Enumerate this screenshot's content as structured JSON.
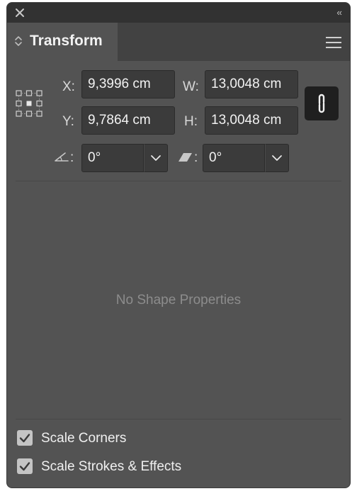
{
  "panel": {
    "title": "Transform",
    "icons": {
      "close": "close-icon",
      "collapse": "double-chevron-left-icon",
      "menu": "hamburger-menu-icon",
      "tab_toggle": "updown-chevron-icon"
    },
    "collapse_glyph": "‹‹"
  },
  "fields": {
    "x": {
      "label": "X:",
      "value": "9,3996 cm"
    },
    "y": {
      "label": "Y:",
      "value": "9,7864 cm"
    },
    "w": {
      "label": "W:",
      "value": "13,0048 cm"
    },
    "h": {
      "label": "H:",
      "value": "13,0048 cm"
    },
    "rotate": {
      "label": ":",
      "value": "0°",
      "icon": "angle-icon"
    },
    "shear": {
      "label": ":",
      "value": "0°",
      "icon": "shear-icon"
    }
  },
  "constrain": {
    "icon": "link-icon",
    "active": true
  },
  "empty_state": "No Shape Properties",
  "options": [
    {
      "label": "Scale Corners",
      "checked": true
    },
    {
      "label": "Scale Strokes & Effects",
      "checked": true
    }
  ],
  "colors": {
    "panel_bg": "#535353",
    "topbar_bg": "#323232",
    "field_bg": "#3b3b3b",
    "link_button_bg": "#1f1f1f",
    "checkbox_bg": "#c4c4c4"
  }
}
